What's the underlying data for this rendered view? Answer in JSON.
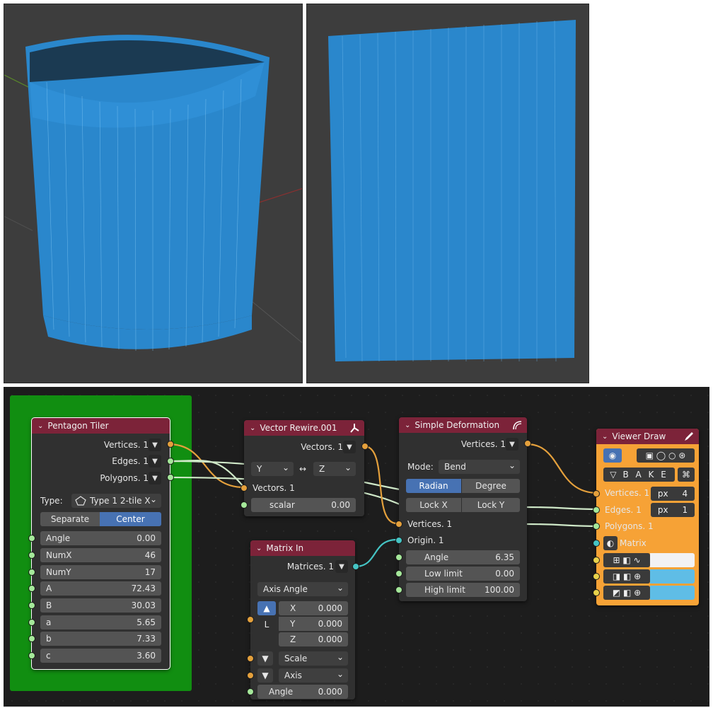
{
  "viewports": {
    "left": {
      "description_label": ""
    },
    "right": {
      "description_label": ""
    }
  },
  "colors": {
    "mesh": "#2a87cc",
    "frame": "#118e11",
    "node_header": "#7c2339",
    "socket_vector": "#e4a03c",
    "socket_value": "#a5e89a",
    "socket_matrix": "#45c4c4",
    "socket_color": "#e8d24b",
    "accent": "#4772b3",
    "viewer_bg": "#f6a236"
  },
  "pentagon_tiler": {
    "title": "Pentagon Tiler",
    "outputs": [
      "Vertices. 1",
      "Edges. 1",
      "Polygons. 1"
    ],
    "type_label": "Type:",
    "type_value": "Type 1 2-tile X",
    "mode_left": "Separate",
    "mode_right": "Center",
    "params": [
      {
        "label": "Angle",
        "value": "0.00"
      },
      {
        "label": "NumX",
        "value": "46"
      },
      {
        "label": "NumY",
        "value": "17"
      },
      {
        "label": "A",
        "value": "72.43"
      },
      {
        "label": "B",
        "value": "30.03"
      },
      {
        "label": "a",
        "value": "5.65"
      },
      {
        "label": "b",
        "value": "7.33"
      },
      {
        "label": "c",
        "value": "3.60"
      }
    ]
  },
  "vector_rewire": {
    "title": "Vector Rewire.001",
    "output": "Vectors. 1",
    "from_axis": "Y",
    "swap_symbol": "↔",
    "to_axis": "Z",
    "input": "Vectors. 1",
    "scalar_label": "scalar",
    "scalar_value": "0.00"
  },
  "matrix_in": {
    "title": "Matrix In",
    "output": "Matrices. 1",
    "mode": "Axis Angle",
    "loc_label": "L",
    "x_label": "X",
    "x_value": "0.000",
    "y_label": "Y",
    "y_value": "0.000",
    "z_label": "Z",
    "z_value": "0.000",
    "scale_label": "Scale",
    "axis_label": "Axis",
    "angle_label": "Angle",
    "angle_value": "0.000"
  },
  "simple_deformation": {
    "title": "Simple Deformation",
    "output": "Vertices. 1",
    "mode_label": "Mode:",
    "mode_value": "Bend",
    "unit_left": "Radian",
    "unit_right": "Degree",
    "lock_x": "Lock X",
    "lock_y": "Lock Y",
    "in_vertices": "Vertices. 1",
    "in_origin": "Origin. 1",
    "angle_label": "Angle",
    "angle_value": "6.35",
    "low_label": "Low limit",
    "low_value": "0.00",
    "high_label": "High limit",
    "high_value": "100.00"
  },
  "viewer_draw": {
    "title": "Viewer Draw",
    "bake": "B A K E",
    "vertices_label": "Vertices. 1",
    "vertices_px_label": "px",
    "vertices_px_value": "4",
    "edges_label": "Edges. 1",
    "edges_px_label": "px",
    "edges_px_value": "1",
    "polygons_label": "Polygons. 1",
    "matrix_label": "Matrix",
    "swatch_1": "#f2f2f4",
    "swatch_2": "#5fbde6",
    "swatch_3": "#5fbde6"
  }
}
